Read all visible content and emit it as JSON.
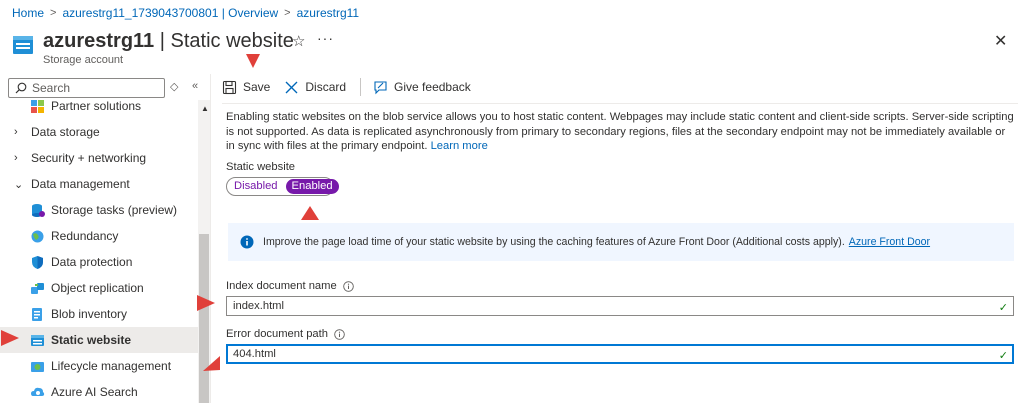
{
  "breadcrumb": [
    "Home",
    "azurestrg11_1739043700801 | Overview",
    "azurestrg11"
  ],
  "header": {
    "resource_name": "azurestrg11",
    "title_suffix": "| Static website",
    "subtitle": "Storage account"
  },
  "sidebar": {
    "search_placeholder": "Search",
    "items": [
      {
        "label": "Partner solutions",
        "icon": "partner-icon",
        "type": "child"
      },
      {
        "label": "Data storage",
        "icon": "chevron-right-icon",
        "type": "group"
      },
      {
        "label": "Security + networking",
        "icon": "chevron-right-icon",
        "type": "group"
      },
      {
        "label": "Data management",
        "icon": "chevron-down-icon",
        "type": "group"
      },
      {
        "label": "Storage tasks (preview)",
        "icon": "storage-tasks-icon",
        "type": "child"
      },
      {
        "label": "Redundancy",
        "icon": "globe-icon",
        "type": "child"
      },
      {
        "label": "Data protection",
        "icon": "shield-icon",
        "type": "child"
      },
      {
        "label": "Object replication",
        "icon": "replication-icon",
        "type": "child"
      },
      {
        "label": "Blob inventory",
        "icon": "inventory-icon",
        "type": "child"
      },
      {
        "label": "Static website",
        "icon": "static-website-icon",
        "type": "child",
        "selected": true
      },
      {
        "label": "Lifecycle management",
        "icon": "lifecycle-icon",
        "type": "child"
      },
      {
        "label": "Azure AI Search",
        "icon": "cloud-search-icon",
        "type": "child"
      }
    ]
  },
  "toolbar": {
    "save_label": "Save",
    "discard_label": "Discard",
    "feedback_label": "Give feedback"
  },
  "main": {
    "description": "Enabling static websites on the blob service allows you to host static content. Webpages may include static content and client-side scripts. Server-side scripting is not supported. As data is replicated asynchronously from primary to secondary regions, files at the secondary endpoint may not be immediately available or in sync with files at the primary endpoint.",
    "learn_more": "Learn more",
    "static_website_label": "Static website",
    "toggle": {
      "disabled": "Disabled",
      "enabled": "Enabled",
      "selected": "Enabled"
    },
    "info_text": "Improve the page load time of your static website by using the caching features of Azure Front Door (Additional costs apply).",
    "info_link": "Azure Front Door",
    "index_label": "Index document name",
    "index_value": "index.html",
    "error_label": "Error document path",
    "error_value": "404.html"
  },
  "colors": {
    "link": "#0067b8",
    "toggle_accent": "#7719aa",
    "focus": "#0078d4",
    "valid": "#107c10",
    "annotation_arrow": "#e0403a"
  }
}
